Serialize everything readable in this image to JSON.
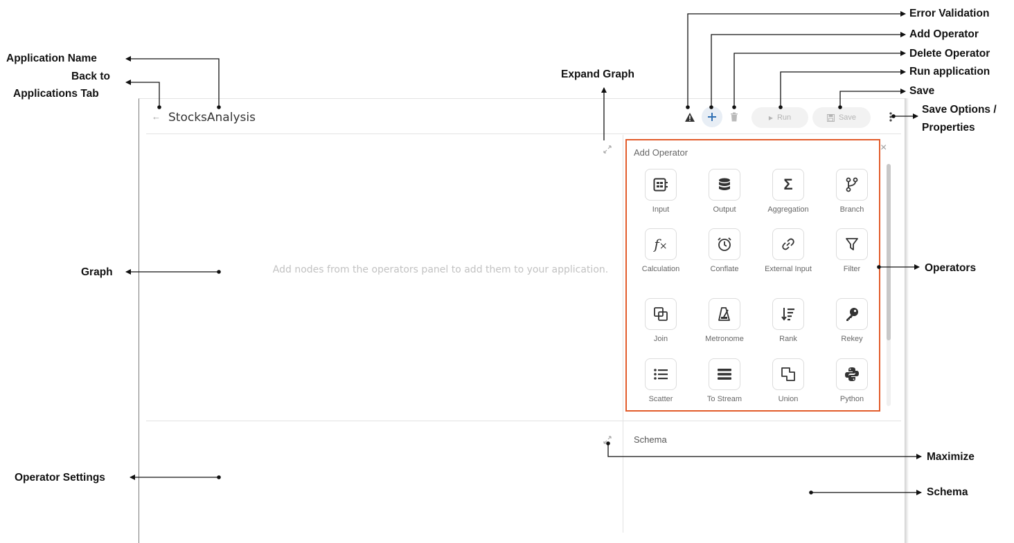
{
  "app": {
    "name": "StocksAnalysis",
    "back_icon": "arrow-left-icon",
    "toolbar": {
      "run_label": "Run",
      "save_label": "Save"
    }
  },
  "graph": {
    "hint": "Add nodes from the operators panel to add them to your application."
  },
  "operators_panel": {
    "title": "Add Operator",
    "items": [
      {
        "label": "Input",
        "icon": "input-icon"
      },
      {
        "label": "Output",
        "icon": "database-icon"
      },
      {
        "label": "Aggregation",
        "icon": "sigma-icon"
      },
      {
        "label": "Branch",
        "icon": "branch-icon"
      },
      {
        "label": "Calculation",
        "icon": "function-icon"
      },
      {
        "label": "Conflate",
        "icon": "alarm-clock-icon"
      },
      {
        "label": "External Input",
        "icon": "link-icon"
      },
      {
        "label": "Filter",
        "icon": "filter-icon"
      },
      {
        "label": "Join",
        "icon": "join-icon"
      },
      {
        "label": "Metronome",
        "icon": "metronome-icon"
      },
      {
        "label": "Rank",
        "icon": "rank-icon"
      },
      {
        "label": "Rekey",
        "icon": "key-icon"
      },
      {
        "label": "Scatter",
        "icon": "list-icon"
      },
      {
        "label": "To Stream",
        "icon": "stream-icon"
      },
      {
        "label": "Union",
        "icon": "union-icon"
      },
      {
        "label": "Python",
        "icon": "python-icon"
      }
    ]
  },
  "schema": {
    "title": "Schema"
  },
  "annotations": {
    "application_name": "Application Name",
    "back_to": "Back to",
    "applications_tab": "Applications Tab",
    "graph": "Graph",
    "operator_settings": "Operator Settings",
    "expand_graph": "Expand Graph",
    "error_validation": "Error Validation",
    "add_operator": "Add Operator",
    "delete_operator": "Delete Operator",
    "run_application": "Run application",
    "save": "Save",
    "save_options": "Save Options /",
    "properties": "Properties",
    "operators": "Operators",
    "maximize": "Maximize",
    "schema": "Schema"
  },
  "colors": {
    "panel_border": "#e25b2a",
    "accent": "#2f6fb3"
  }
}
